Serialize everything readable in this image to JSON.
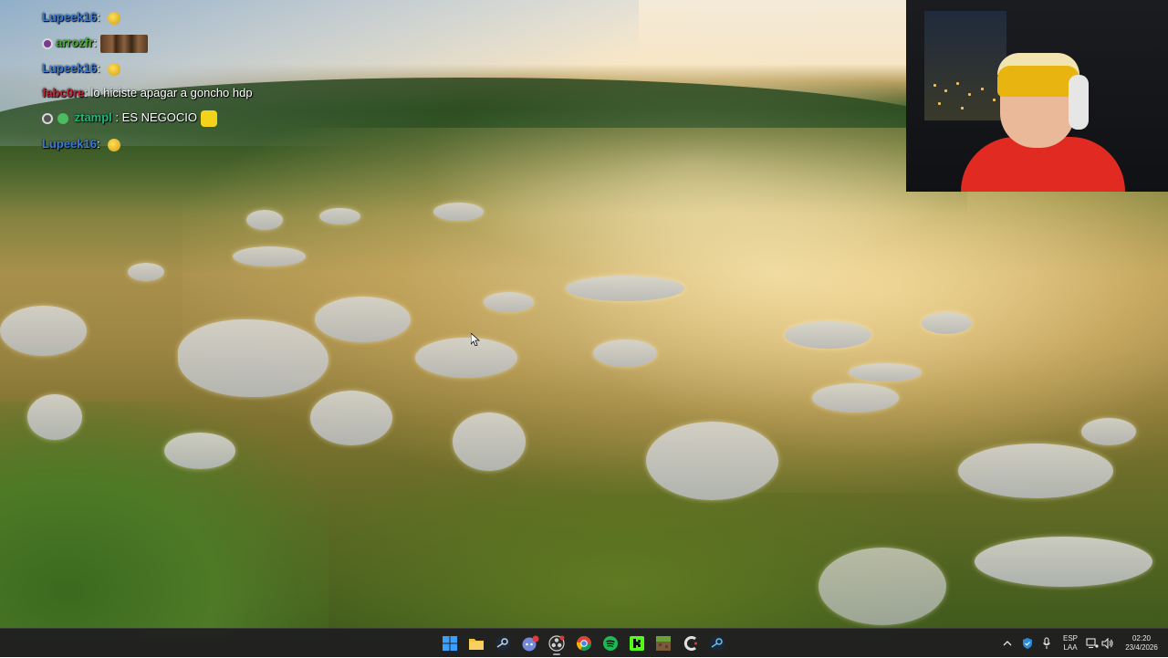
{
  "chat": {
    "messages": [
      {
        "user": "Lupeek16",
        "user_color": "#3a7bd5",
        "separator": ":",
        "text": "",
        "emote": "small"
      },
      {
        "user": "arrozfr",
        "user_color": "#4ea83a",
        "separator": ":",
        "text": "",
        "emote": "wide",
        "badge": "circle"
      },
      {
        "user": "Lupeek16",
        "user_color": "#3a7bd5",
        "separator": ":",
        "text": "",
        "emote": "small"
      },
      {
        "user": "fabc0re",
        "user_color": "#c0283a",
        "separator": ":",
        "text": "lo hiciste apagar a goncho hdp"
      },
      {
        "user": "ztampl",
        "user_color": "#1fb87a",
        "separator": ":",
        "text": "ES NEGOCIO",
        "emote": "yellow",
        "badge": "double"
      },
      {
        "user": "Lupeek16",
        "user_color": "#3a7bd5",
        "separator": ":",
        "text": "",
        "emote": "small"
      }
    ]
  },
  "taskbar": {
    "apps": [
      {
        "name": "windows-start-icon",
        "color": "#3aa0ff"
      },
      {
        "name": "file-explorer-icon",
        "color": "#f5c542"
      },
      {
        "name": "steam-icon",
        "color": "#c7d5e0"
      },
      {
        "name": "discord-icon",
        "color": "#7289da",
        "badge": "99"
      },
      {
        "name": "obs-icon",
        "color": "#d0d0d0",
        "active": true
      },
      {
        "name": "chrome-icon",
        "color": "#4285f4"
      },
      {
        "name": "spotify-icon",
        "color": "#1db954"
      },
      {
        "name": "kick-icon",
        "color": "#53fc18"
      },
      {
        "name": "minecraft-icon",
        "color": "#7a9a3a"
      },
      {
        "name": "ccleaner-icon",
        "color": "#e0e0e0"
      },
      {
        "name": "steam-alt-icon",
        "color": "#66c0f4"
      }
    ],
    "tray": {
      "language_top": "ESP",
      "language_bottom": "LAA",
      "time": "02:20",
      "date": "23/4/2026"
    }
  }
}
